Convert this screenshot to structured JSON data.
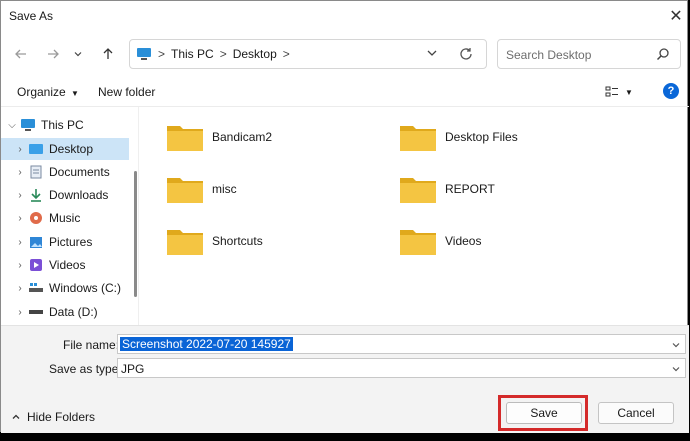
{
  "window": {
    "title": "Save As",
    "close_glyph": "✕"
  },
  "nav_buttons": {
    "back_icon": "arrow-left-icon",
    "forward_icon": "arrow-right-icon",
    "recent_icon": "chevron-down-icon",
    "up_icon": "arrow-up-icon"
  },
  "address_bar": {
    "crumbs": [
      "This PC",
      "Desktop"
    ],
    "separator": ">"
  },
  "search": {
    "placeholder": "Search Desktop"
  },
  "toolbar": {
    "organize_label": "Organize",
    "new_folder_label": "New folder",
    "help_label": "?"
  },
  "sidebar": {
    "items": [
      {
        "label": "This PC",
        "icon": "computer-icon",
        "expanded": true
      },
      {
        "label": "Desktop",
        "icon": "desktop-icon",
        "selected": true
      },
      {
        "label": "Documents",
        "icon": "documents-icon"
      },
      {
        "label": "Downloads",
        "icon": "downloads-icon"
      },
      {
        "label": "Music",
        "icon": "music-icon"
      },
      {
        "label": "Pictures",
        "icon": "pictures-icon"
      },
      {
        "label": "Videos",
        "icon": "videos-icon"
      },
      {
        "label": "Windows (C:)",
        "icon": "drive-c-icon"
      },
      {
        "label": "Data (D:)",
        "icon": "drive-d-icon"
      }
    ]
  },
  "folders": [
    {
      "name": "Bandicam2"
    },
    {
      "name": "Desktop Files"
    },
    {
      "name": "misc"
    },
    {
      "name": "REPORT"
    },
    {
      "name": "Shortcuts"
    },
    {
      "name": "Videos"
    }
  ],
  "form": {
    "file_name_label": "File name:",
    "file_name_value": "Screenshot 2022-07-20 145927",
    "save_type_label": "Save as type:",
    "save_type_value": "JPG"
  },
  "footer": {
    "hide_folders_label": "Hide Folders",
    "save_label": "Save",
    "cancel_label": "Cancel"
  },
  "colors": {
    "folder_yellow": "#f4c542",
    "folder_dark": "#e0a91c",
    "selection_blue": "#0a64d6",
    "sidebar_selected": "#cce4f7",
    "highlight_red": "#d42a2a",
    "help_blue": "#0a67d8"
  }
}
